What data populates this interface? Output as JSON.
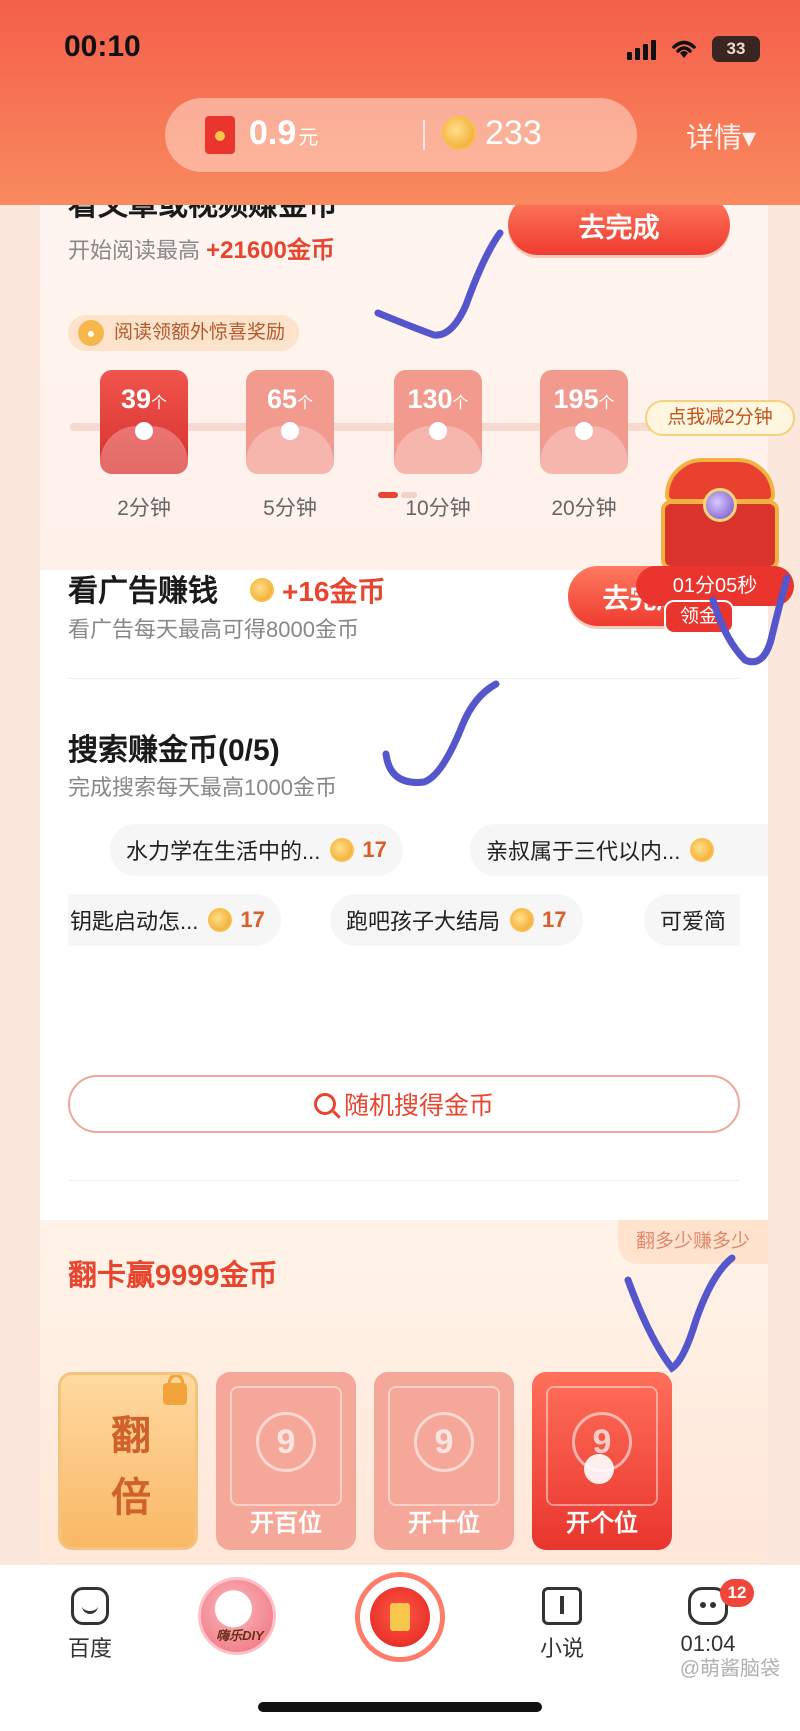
{
  "status_bar": {
    "time": "00:10",
    "battery": "33"
  },
  "header": {
    "cash_value": "0.9",
    "cash_unit": "元",
    "coin_value": "233",
    "detail_label": "详情▾"
  },
  "read_section": {
    "title": "看文章或视频赚金币",
    "subtitle_prefix": "开始阅读最高",
    "subtitle_bonus": "+21600金币",
    "action_label": "去完成",
    "bonus_tag": "阅读领额外惊喜奖励",
    "envelopes": [
      {
        "amount": "39",
        "unit": "个",
        "time": "2分钟",
        "active": true
      },
      {
        "amount": "65",
        "unit": "个",
        "time": "5分钟",
        "active": false
      },
      {
        "amount": "130",
        "unit": "个",
        "time": "10分钟",
        "active": false
      },
      {
        "amount": "195",
        "unit": "个",
        "time": "20分钟",
        "active": false
      }
    ]
  },
  "floating_widget": {
    "tag": "点我减2分钟",
    "countdown": "01分05秒",
    "claim_label": "领金"
  },
  "ad_section": {
    "title": "看广告赚钱",
    "reward": "+16金币",
    "subtitle": "看广告每天最高可得8000金币",
    "action_label": "去完成"
  },
  "search_section": {
    "title": "搜索赚金币(0/5)",
    "subtitle": "完成搜索每天最高1000金币",
    "row1": [
      {
        "text": "水力学在生活中的...",
        "coins": "17"
      },
      {
        "text": "亲叔属于三代以内...",
        "coins": ""
      }
    ],
    "row2": [
      {
        "text": "钥匙启动怎...",
        "coins": "17"
      },
      {
        "text": "跑吧孩子大结局",
        "coins": "17"
      },
      {
        "text": "可爱简",
        "coins": ""
      }
    ],
    "random_button": "随机搜得金币"
  },
  "flip_section": {
    "title": "翻卡赢9999金币",
    "corner_label": "翻多少赚多少",
    "double_card": {
      "line1": "翻",
      "line2": "倍"
    },
    "cards": [
      {
        "digit": "9",
        "label": "开百位"
      },
      {
        "digit": "9",
        "label": "开十位"
      },
      {
        "digit": "9",
        "label": "开个位"
      }
    ]
  },
  "tabbar": {
    "items": [
      {
        "label": "百度"
      },
      {
        "label": "嗨乐DIY"
      },
      {
        "label": ""
      },
      {
        "label": "小说"
      },
      {
        "label": "01:04",
        "badge": "12"
      }
    ]
  },
  "watermark": "@萌酱脑袋",
  "colors": {
    "accent": "#E8452F",
    "header": "#F45F4A",
    "gold": "#F0A020",
    "check_ink": "#5555CC"
  }
}
